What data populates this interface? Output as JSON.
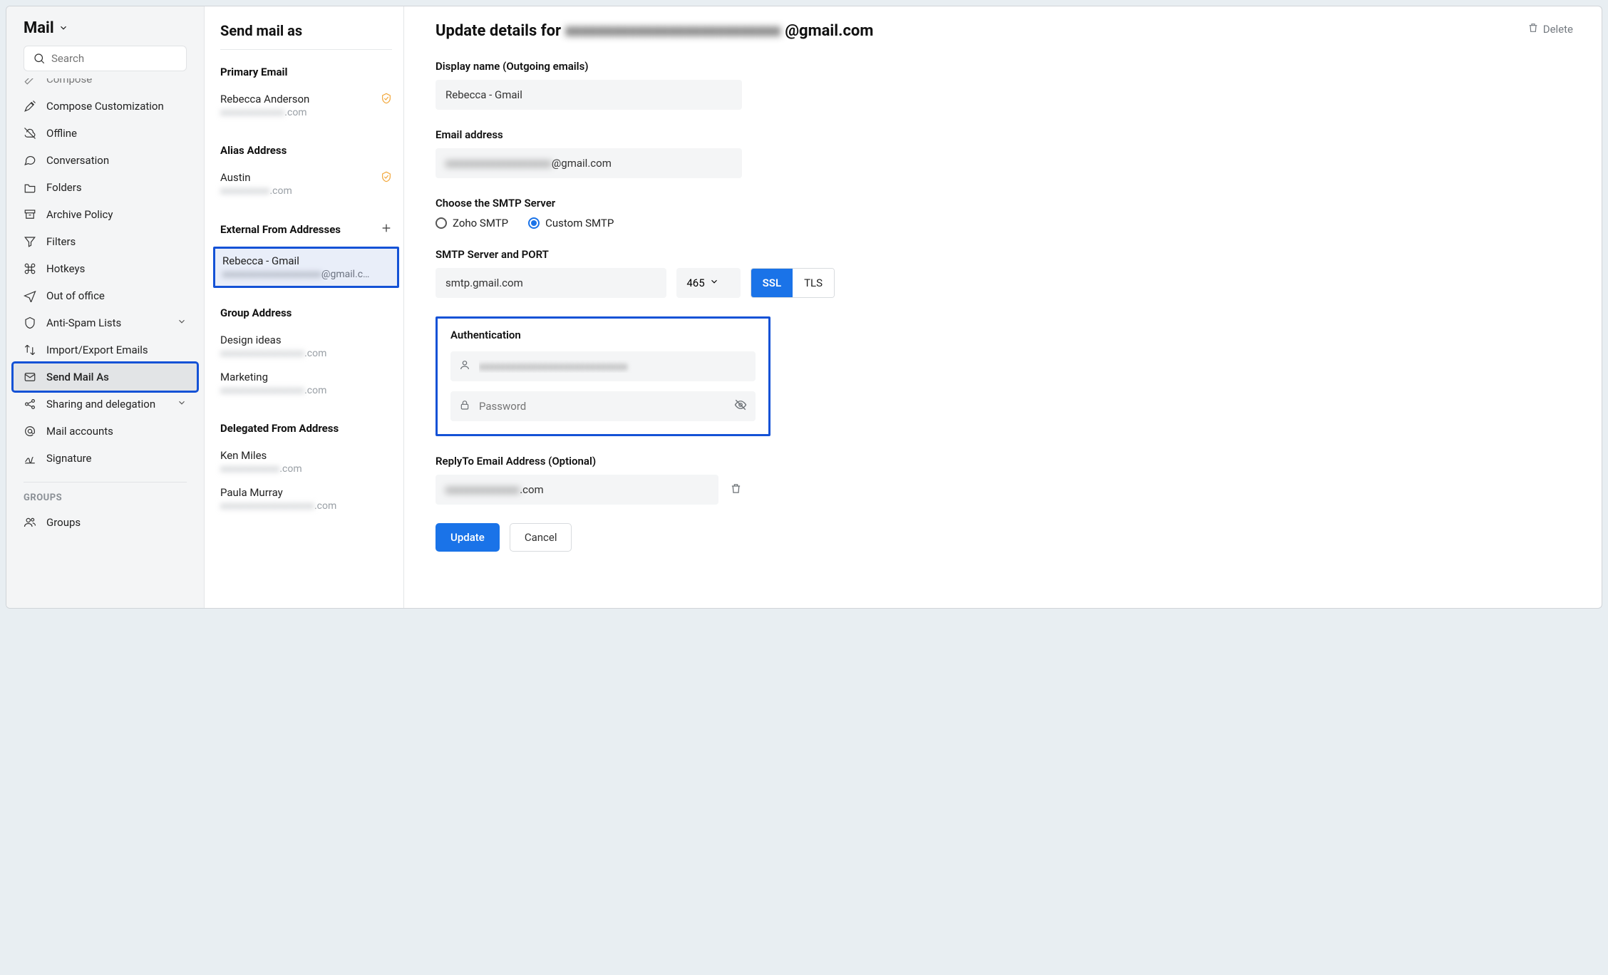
{
  "app": {
    "title": "Mail"
  },
  "search": {
    "placeholder": "Search"
  },
  "nav": {
    "items": [
      {
        "label": "Compose"
      },
      {
        "label": "Compose Customization"
      },
      {
        "label": "Offline"
      },
      {
        "label": "Conversation"
      },
      {
        "label": "Folders"
      },
      {
        "label": "Archive Policy"
      },
      {
        "label": "Filters"
      },
      {
        "label": "Hotkeys"
      },
      {
        "label": "Out of office"
      },
      {
        "label": "Anti-Spam Lists"
      },
      {
        "label": "Import/Export Emails"
      },
      {
        "label": "Send Mail As"
      },
      {
        "label": "Sharing and delegation"
      },
      {
        "label": "Mail accounts"
      },
      {
        "label": "Signature"
      }
    ],
    "groups_label": "GROUPS",
    "groups_item": "Groups"
  },
  "mid": {
    "title": "Send mail as",
    "primary_label": "Primary Email",
    "primary": {
      "name": "Rebecca Anderson",
      "email_suffix": ".com"
    },
    "alias_label": "Alias Address",
    "alias": {
      "name": "Austin",
      "email_suffix": ".com"
    },
    "external_label": "External From Addresses",
    "external_selected": {
      "name": "Rebecca - Gmail",
      "email_suffix": "@gmail.c…"
    },
    "group_label": "Group Address",
    "groups": [
      {
        "name": "Design ideas",
        "email_suffix": ".com"
      },
      {
        "name": "Marketing",
        "email_suffix": ".com"
      }
    ],
    "delegated_label": "Delegated From Address",
    "delegated": [
      {
        "name": "Ken Miles",
        "email_suffix": ".com"
      },
      {
        "name": "Paula Murray",
        "email_suffix": ".com"
      }
    ]
  },
  "main": {
    "title_prefix": "Update details for",
    "title_email_suffix": "@gmail.com",
    "delete_label": "Delete",
    "display_name_label": "Display name (Outgoing emails)",
    "display_name_value": "Rebecca - Gmail",
    "email_label": "Email address",
    "email_value_suffix": "@gmail.com",
    "smtp_choice_label": "Choose the SMTP Server",
    "smtp_zoho": "Zoho SMTP",
    "smtp_custom": "Custom SMTP",
    "smtp_server_label": "SMTP Server and PORT",
    "smtp_server_value": "smtp.gmail.com",
    "smtp_port_value": "465",
    "ssl_label": "SSL",
    "tls_label": "TLS",
    "auth_label": "Authentication",
    "auth_password_placeholder": "Password",
    "replyto_label": "ReplyTo Email Address (Optional)",
    "replyto_value_suffix": ".com",
    "update_btn": "Update",
    "cancel_btn": "Cancel"
  }
}
